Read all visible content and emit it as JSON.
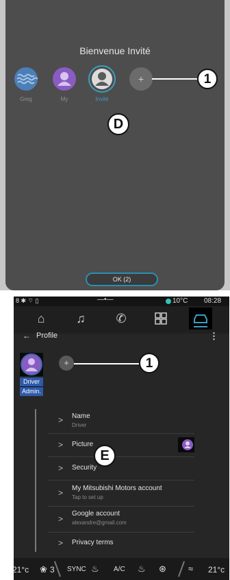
{
  "screenD": {
    "welcome": "Bienvenue Invité",
    "profiles": [
      {
        "label": "Greg",
        "icon": "waves-avatar-icon",
        "color": "#4c7fb8"
      },
      {
        "label": "My",
        "icon": "user-avatar-icon",
        "color": "#8a5cc2"
      },
      {
        "label": "Invité",
        "icon": "guest-avatar-icon",
        "color": "#dcdcdc",
        "selected": true
      }
    ],
    "add_symbol": "+",
    "callout_1": "1",
    "label_D": "D",
    "ok_button": "OK (2)"
  },
  "screenE": {
    "status": {
      "left": "8 ✱ ⌔ ▯",
      "temp": "10°C",
      "time": "08:28"
    },
    "nav_icons": [
      "home-icon",
      "music-icon",
      "phone-icon",
      "apps-icon",
      "car-icon"
    ],
    "header": {
      "back": "←",
      "title": "Profile",
      "menu": "⋮"
    },
    "profile": {
      "line1": "Driver",
      "line2": "Admin."
    },
    "add_symbol": "+",
    "callout_1": "1",
    "label_E": "E",
    "rows": [
      {
        "title": "Name",
        "sub": "Driver"
      },
      {
        "title": "Picture",
        "sub": ""
      },
      {
        "title": "Security",
        "sub": ""
      },
      {
        "title": "My Mitsubishi Motors account",
        "sub": "Tap to set up"
      },
      {
        "title": "Google account",
        "sub": "alexandre@gmail.com"
      },
      {
        "title": "Privacy terms",
        "sub": ""
      }
    ],
    "chevron": ">",
    "bottom": {
      "temp_left": "21°c",
      "fan": "3",
      "sync": "SYNC",
      "ac": "A/C",
      "temp_right": "21°c"
    }
  }
}
